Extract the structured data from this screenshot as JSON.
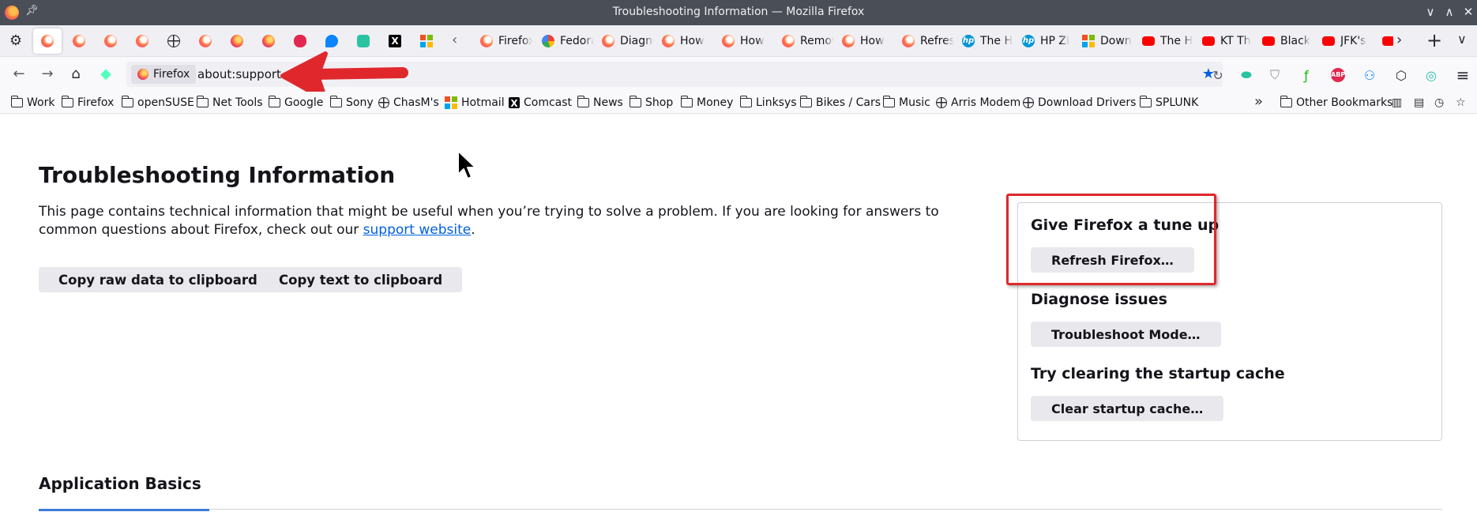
{
  "window": {
    "title": "Troubleshooting Information — Mozilla Firefox"
  },
  "tabs": {
    "pinned_icons": [
      "firefox-icon",
      "firefox-icon",
      "firefox-icon",
      "firefox-icon",
      "globe-icon",
      "firefox-icon",
      "firefox-icon",
      "firefox-icon",
      "red-mascot-icon",
      "chat-icon",
      "phone-icon",
      "x-icon",
      "windows-icon"
    ],
    "items": [
      {
        "label": "Firefox",
        "icon": "firefox-icon"
      },
      {
        "label": "Fedora",
        "icon": "google-icon"
      },
      {
        "label": "Diagnose",
        "icon": "firefox-icon"
      },
      {
        "label": "How",
        "icon": "firefox-icon"
      },
      {
        "label": "How",
        "icon": "firefox-icon"
      },
      {
        "label": "Remove",
        "icon": "firefox-icon"
      },
      {
        "label": "How",
        "icon": "firefox-icon"
      },
      {
        "label": "Refresh",
        "icon": "firefox-icon"
      },
      {
        "label": "The H",
        "icon": "hp-icon"
      },
      {
        "label": "HP ZI",
        "icon": "hp-icon"
      },
      {
        "label": "Down",
        "icon": "windows-icon"
      },
      {
        "label": "The H",
        "icon": "youtube-icon"
      },
      {
        "label": "KT Th",
        "icon": "youtube-icon"
      },
      {
        "label": "Black",
        "icon": "youtube-icon"
      },
      {
        "label": "JFK's",
        "icon": "youtube-icon"
      }
    ]
  },
  "navbar": {
    "identity_label": "Firefox",
    "url": "about:support"
  },
  "bookmarks": [
    {
      "label": "Work",
      "icon": "folder-icon"
    },
    {
      "label": "Firefox",
      "icon": "folder-icon"
    },
    {
      "label": "openSUSE",
      "icon": "folder-icon"
    },
    {
      "label": "Net Tools",
      "icon": "folder-icon"
    },
    {
      "label": "Google",
      "icon": "folder-icon"
    },
    {
      "label": "Sony",
      "icon": "folder-icon"
    },
    {
      "label": "ChasM's",
      "icon": "globe-icon"
    },
    {
      "label": "Hotmail",
      "icon": "windows-icon"
    },
    {
      "label": "Comcast",
      "icon": "x-icon"
    },
    {
      "label": "News",
      "icon": "folder-icon"
    },
    {
      "label": "Shop",
      "icon": "folder-icon"
    },
    {
      "label": "Money",
      "icon": "folder-icon"
    },
    {
      "label": "Linksys",
      "icon": "folder-icon"
    },
    {
      "label": "Bikes / Cars",
      "icon": "folder-icon"
    },
    {
      "label": "Music",
      "icon": "folder-icon"
    },
    {
      "label": "Arris Modem",
      "icon": "globe-icon"
    },
    {
      "label": "Download Drivers",
      "icon": "globe-icon"
    },
    {
      "label": "SPLUNK",
      "icon": "folder-icon"
    }
  ],
  "other_bookmarks": "Other Bookmarks",
  "page": {
    "title": "Troubleshooting Information",
    "intro_text": "This page contains technical information that might be useful when you’re trying to solve a problem. If you are looking for answers to common questions about Firefox, check out our ",
    "intro_link": "support website",
    "intro_end": ".",
    "copy_raw_button": "Copy raw data to clipboard",
    "copy_text_button": "Copy text to clipboard",
    "sidebox": {
      "tuneup_heading": "Give Firefox a tune up",
      "refresh_button": "Refresh Firefox…",
      "diagnose_heading": "Diagnose issues",
      "troubleshoot_button": "Troubleshoot Mode…",
      "cache_heading": "Try clearing the startup cache",
      "clear_cache_button": "Clear startup cache…"
    },
    "section_title": "Application Basics"
  },
  "colors": {
    "annotation": "#e0282c",
    "link": "#0060df",
    "titlebar": "#4a4e57"
  }
}
